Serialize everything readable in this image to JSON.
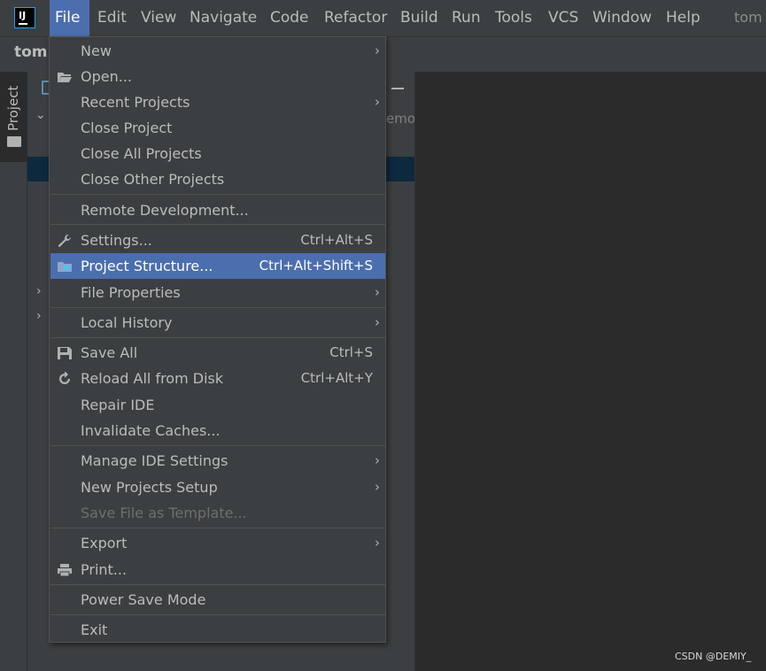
{
  "menubar": {
    "logo_text": "IJ",
    "items": [
      {
        "label": "File",
        "mnemonic": "F"
      },
      {
        "label": "Edit",
        "mnemonic": "E"
      },
      {
        "label": "View",
        "mnemonic": "V"
      },
      {
        "label": "Navigate",
        "mnemonic": "N"
      },
      {
        "label": "Code",
        "mnemonic": "C"
      },
      {
        "label": "Refactor",
        "mnemonic": "R"
      },
      {
        "label": "Build",
        "mnemonic": "B"
      },
      {
        "label": "Run",
        "mnemonic": "u"
      },
      {
        "label": "Tools",
        "mnemonic": "T"
      },
      {
        "label": "VCS",
        "mnemonic": ""
      },
      {
        "label": "Window",
        "mnemonic": "W"
      },
      {
        "label": "Help",
        "mnemonic": "H"
      }
    ],
    "window_title_tail": "tom"
  },
  "titlebar": {
    "project_name": "tom"
  },
  "sidebar": {
    "project_tab_label": "Project"
  },
  "project_panel": {
    "path_hint": "emo"
  },
  "file_menu": {
    "items": [
      {
        "label": "New",
        "shortcut": "",
        "submenu": true,
        "icon": ""
      },
      {
        "label": "Open...",
        "shortcut": "",
        "submenu": false,
        "icon": "folder-open-icon"
      },
      {
        "label": "Recent Projects",
        "shortcut": "",
        "submenu": true,
        "icon": ""
      },
      {
        "label": "Close Project",
        "shortcut": "",
        "submenu": false,
        "icon": ""
      },
      {
        "label": "Close All Projects",
        "shortcut": "",
        "submenu": false,
        "icon": ""
      },
      {
        "label": "Close Other Projects",
        "shortcut": "",
        "submenu": false,
        "icon": ""
      },
      {
        "label": "Remote Development...",
        "shortcut": "",
        "submenu": false,
        "icon": ""
      },
      {
        "label": "Settings...",
        "shortcut": "Ctrl+Alt+S",
        "submenu": false,
        "icon": "wrench-icon"
      },
      {
        "label": "Project Structure...",
        "shortcut": "Ctrl+Alt+Shift+S",
        "submenu": false,
        "icon": "project-structure-icon",
        "selected": true
      },
      {
        "label": "File Properties",
        "shortcut": "",
        "submenu": true,
        "icon": ""
      },
      {
        "label": "Local History",
        "shortcut": "",
        "submenu": true,
        "icon": ""
      },
      {
        "label": "Save All",
        "shortcut": "Ctrl+S",
        "submenu": false,
        "icon": "save-icon"
      },
      {
        "label": "Reload All from Disk",
        "shortcut": "Ctrl+Alt+Y",
        "submenu": false,
        "icon": "reload-icon"
      },
      {
        "label": "Repair IDE",
        "shortcut": "",
        "submenu": false,
        "icon": ""
      },
      {
        "label": "Invalidate Caches...",
        "shortcut": "",
        "submenu": false,
        "icon": ""
      },
      {
        "label": "Manage IDE Settings",
        "shortcut": "",
        "submenu": true,
        "icon": ""
      },
      {
        "label": "New Projects Setup",
        "shortcut": "",
        "submenu": true,
        "icon": ""
      },
      {
        "label": "Save File as Template...",
        "shortcut": "",
        "submenu": false,
        "icon": "",
        "disabled": true
      },
      {
        "label": "Export",
        "shortcut": "",
        "submenu": true,
        "icon": ""
      },
      {
        "label": "Print...",
        "shortcut": "",
        "submenu": false,
        "icon": "print-icon"
      },
      {
        "label": "Power Save Mode",
        "shortcut": "",
        "submenu": false,
        "icon": ""
      },
      {
        "label": "Exit",
        "shortcut": "",
        "submenu": false,
        "icon": ""
      }
    ]
  },
  "watermark": "CSDN @DEMIY_",
  "colors": {
    "menu_bg": "#3c3f41",
    "selection": "#4b6eaf",
    "editor_bg": "#2b2b2b",
    "text": "#bbbbbb",
    "disabled_text": "#6e6e6e",
    "tree_selection": "#0d293e"
  }
}
